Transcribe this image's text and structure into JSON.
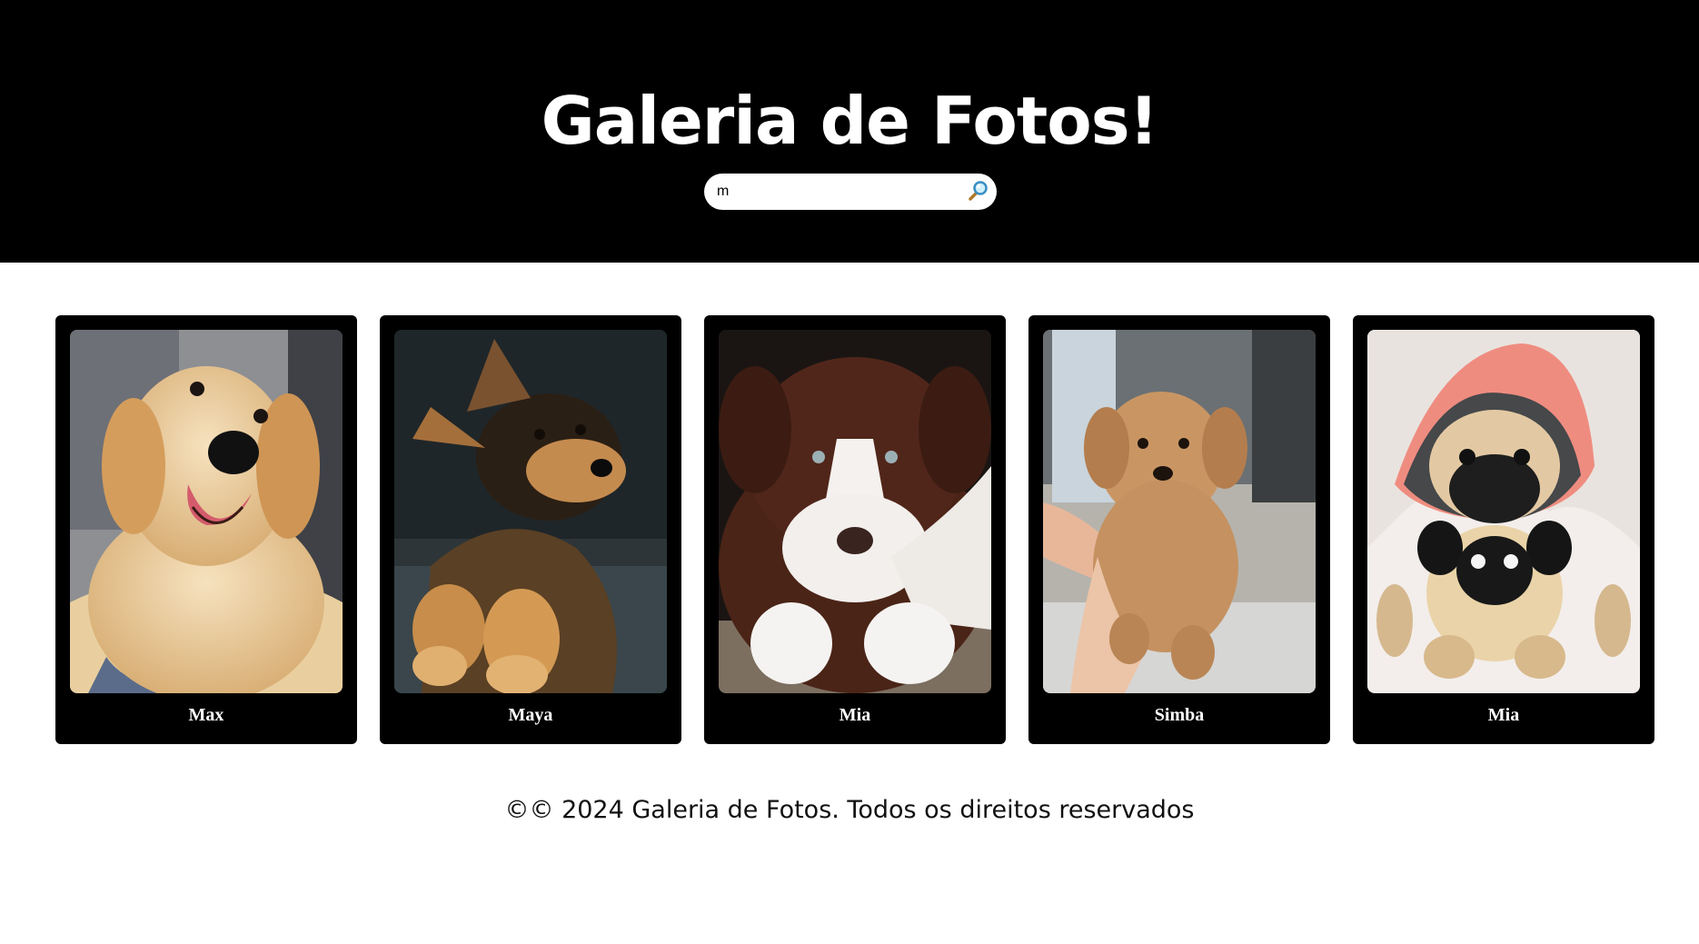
{
  "header": {
    "title": "Galeria de Fotos!",
    "background": "#000000"
  },
  "search": {
    "value": "m",
    "button_icon": "magnifier-icon"
  },
  "gallery": {
    "cards": [
      {
        "name": "Max",
        "photo": "golden-retriever-puppy"
      },
      {
        "name": "Maya",
        "photo": "german-shepherd-puppy"
      },
      {
        "name": "Mia",
        "photo": "brown-white-border-collie-puppy"
      },
      {
        "name": "Simba",
        "photo": "fluffy-apricot-puppy-held-in-hand"
      },
      {
        "name": "Mia",
        "photo": "pug-in-pink-hoodie-with-plush-pug"
      }
    ]
  },
  "footer": {
    "text": "©© 2024 Galeria de Fotos. Todos os direitos reservados"
  }
}
